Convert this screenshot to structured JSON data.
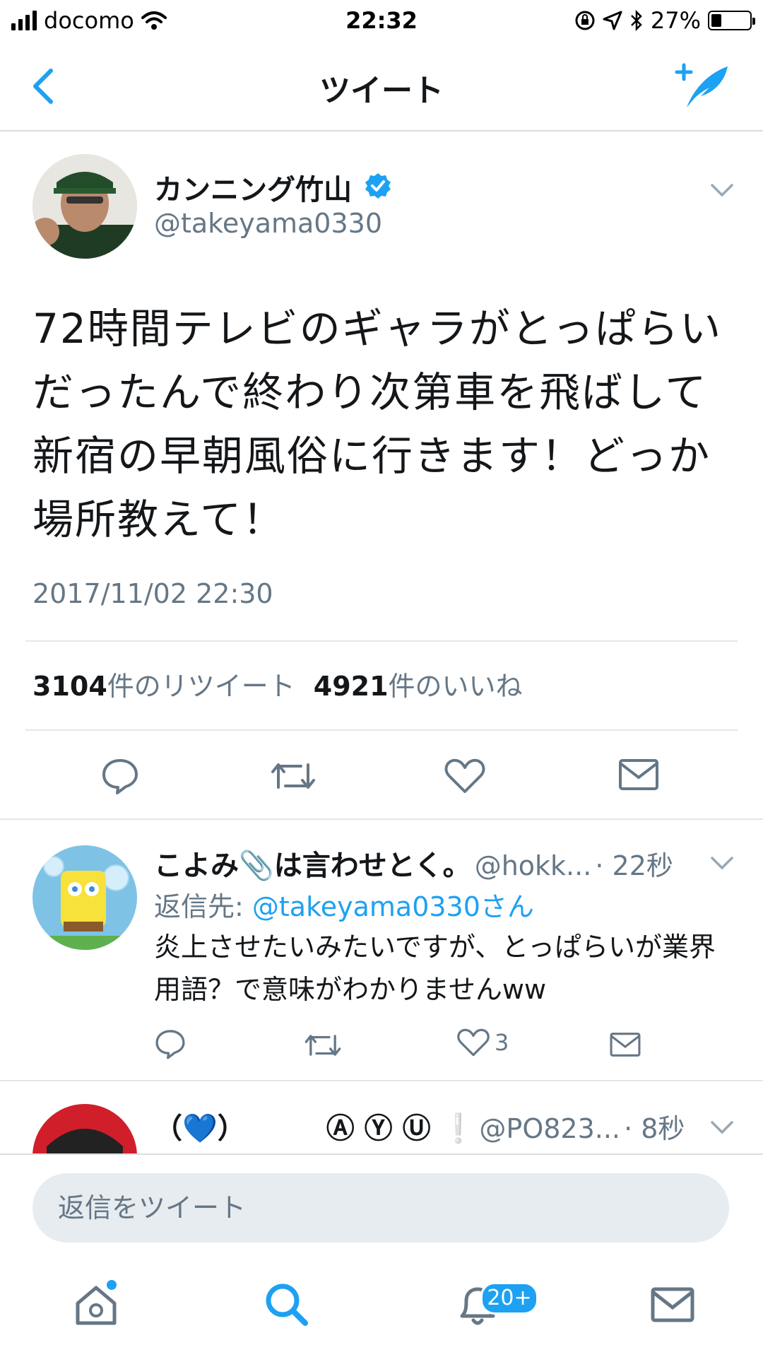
{
  "status_bar": {
    "carrier": "docomo",
    "time": "22:32",
    "battery": "27%",
    "battery_level": 0.27
  },
  "header": {
    "title": "ツイート"
  },
  "tweet": {
    "name": "カンニング竹山",
    "handle": "@takeyama0330",
    "text": "72時間テレビのギャラがとっぱらいだったんで終わり次第車を飛ばして新宿の早朝風俗に行きます！どっか場所教えて！",
    "timestamp": "2017/11/02 22:30",
    "retweets": "3104",
    "retweets_label": "件のリツイート",
    "likes": "4921",
    "likes_label": "件のいいね"
  },
  "replies": [
    {
      "name": "こよみ📎は言わせとく。",
      "handle": "@hokk...",
      "time": "· 22秒",
      "reply_to_prefix": "返信先:",
      "reply_to_link": "@takeyama0330さん",
      "text": "炎上させたいみたいですが、とっぱらいが業界用語？で意味がわかりませんww",
      "like_count": "3"
    },
    {
      "name": "（💙）　　　 Ⓐ Ⓨ Ⓤ ❕",
      "handle": "@PO823...",
      "time": "· 8秒"
    }
  ],
  "reply_input": {
    "placeholder": "返信をツイート"
  },
  "tabbar": {
    "notifications_badge": "20+"
  },
  "colors": {
    "accent": "#1da1f2",
    "text": "#14171a",
    "secondary": "#657786",
    "divider": "#e1e8ed"
  }
}
